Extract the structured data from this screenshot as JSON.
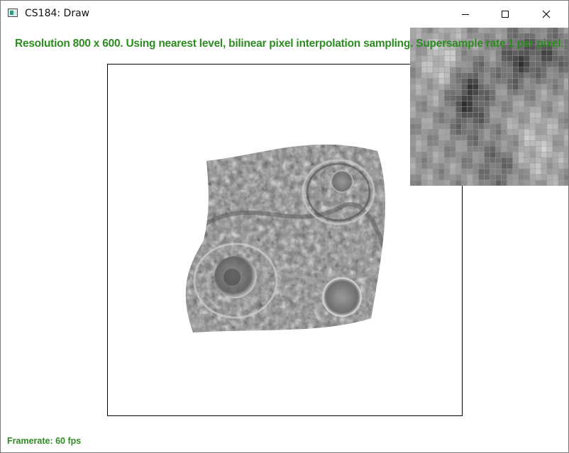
{
  "window": {
    "title": "CS184: Draw"
  },
  "status": {
    "info": "Resolution 800 x 600. Using nearest level, bilinear pixel interpolation sampling. Supersample rate 1 per pixel.",
    "framerate": "Framerate: 60 fps"
  },
  "icons": {
    "app": "app-window-icon",
    "minimize": "minimize-icon",
    "maximize": "maximize-icon",
    "close": "close-icon"
  },
  "colors": {
    "status_text": "#2e8b22",
    "frame_border": "#000000",
    "background": "#ffffff"
  }
}
